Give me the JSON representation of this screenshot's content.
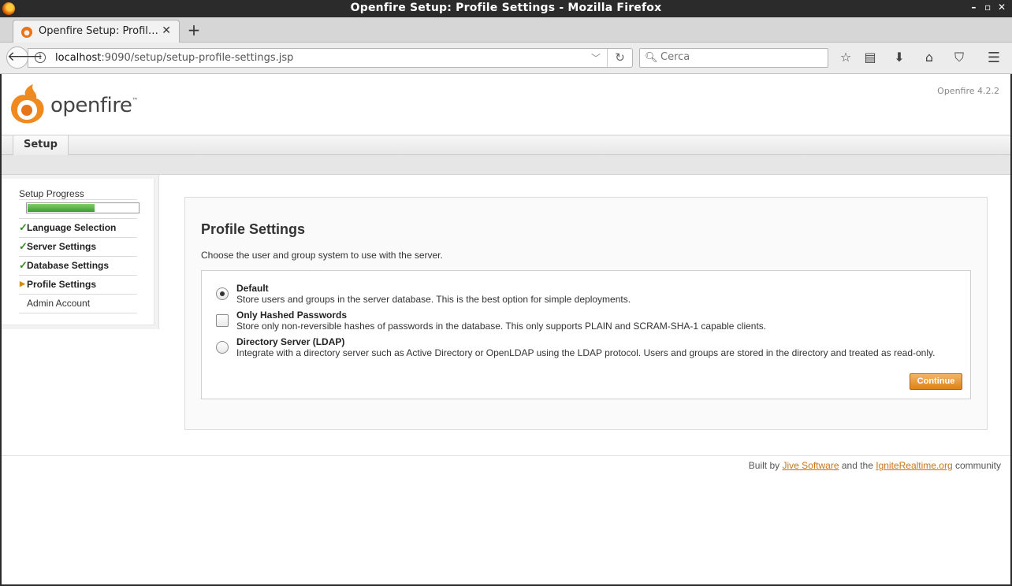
{
  "window": {
    "title": "Openfire Setup: Profile Settings - Mozilla Firefox",
    "controls": [
      "–",
      "▫",
      "✕"
    ]
  },
  "tab": {
    "title": "Openfire Setup: Profil…",
    "new_tab": "+"
  },
  "navbar": {
    "url_host": "localhost",
    "url_rest": ":9090/setup/setup-profile-settings.jsp",
    "search_placeholder": "Cerca"
  },
  "header": {
    "logo_text": "openfire",
    "logo_tm": "™",
    "version": "Openfire 4.2.2"
  },
  "nav": {
    "setup_tab": "Setup"
  },
  "sidebar": {
    "title": "Setup Progress",
    "progress": 0.6,
    "items": [
      {
        "label": "Language Selection",
        "status": "done"
      },
      {
        "label": "Server Settings",
        "status": "done"
      },
      {
        "label": "Database Settings",
        "status": "done"
      },
      {
        "label": "Profile Settings",
        "status": "current"
      },
      {
        "label": "Admin Account",
        "status": "pending"
      }
    ]
  },
  "main": {
    "heading": "Profile Settings",
    "intro": "Choose the user and group system to use with the server.",
    "options": [
      {
        "name": "Default",
        "desc": "Store users and groups in the server database. This is the best option for simple deployments.",
        "control": "radio",
        "selected": true
      },
      {
        "name": "Only Hashed Passwords",
        "desc": "Store only non-reversible hashes of passwords in the database. This only supports PLAIN and SCRAM-SHA-1 capable clients.",
        "control": "checkbox",
        "selected": false
      },
      {
        "name": "Directory Server (LDAP)",
        "desc": "Integrate with a directory server such as Active Directory or OpenLDAP using the LDAP protocol. Users and groups are stored in the directory and treated as read-only.",
        "control": "radio",
        "selected": false
      }
    ],
    "continue_label": "Continue"
  },
  "footer": {
    "built_by": "Built by",
    "jive": "Jive Software",
    "and_the": "and the",
    "ignite": "IgniteRealtime.org",
    "community": "community"
  }
}
